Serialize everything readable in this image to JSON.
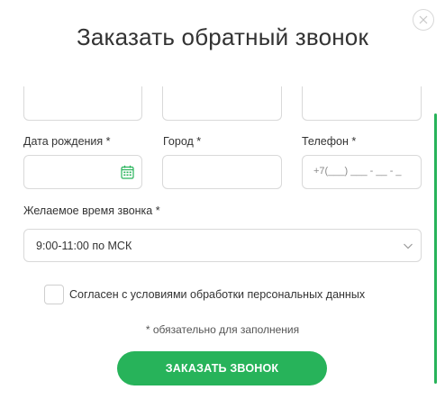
{
  "dialog": {
    "title": "Заказать обратный звонок",
    "close_icon": "close-icon"
  },
  "form": {
    "birth_date": {
      "label": "Дата рождения *",
      "value": "",
      "icon": "calendar-icon"
    },
    "city": {
      "label": "Город *",
      "value": ""
    },
    "phone": {
      "label": "Телефон *",
      "placeholder": "+7(___) ___ - __ - _"
    },
    "call_time": {
      "label": "Желаемое время звонка *",
      "selected": "9:00-11:00 по МСК",
      "icon": "chevron-down-icon"
    },
    "consent": {
      "label": "Согласен с условиями обработки персональных данных",
      "checked": false
    },
    "required_note": "* обязательно для заполнения",
    "submit_label": "ЗАКАЗАТЬ ЗВОНОК"
  },
  "colors": {
    "accent": "#27b35a",
    "border": "#d9d9d9",
    "text": "#333333"
  }
}
